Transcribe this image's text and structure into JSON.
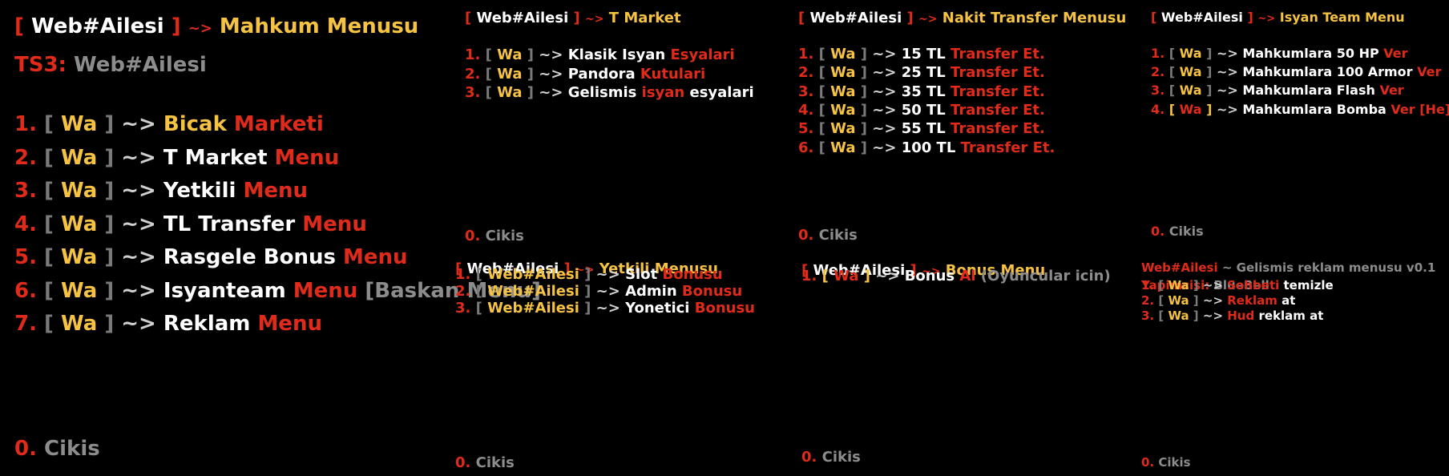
{
  "brand": "Web#Ailesi",
  "tag": "Wa",
  "sep": "~>",
  "exit": {
    "num": "0.",
    "label": "Cikis"
  },
  "mahkum": {
    "title": "Mahkum Menusu",
    "subtitle_prefix": "TS3:",
    "subtitle": "Web#Ailesi",
    "items": [
      {
        "n": "1.",
        "a": "Bicak",
        "b": "Marketi",
        "c": ""
      },
      {
        "n": "2.",
        "a": "T Market",
        "b": "Menu",
        "c": ""
      },
      {
        "n": "3.",
        "a": "Yetkili",
        "b": "Menu",
        "c": ""
      },
      {
        "n": "4.",
        "a": "TL Transfer",
        "b": "Menu",
        "c": ""
      },
      {
        "n": "5.",
        "a": "Rasgele Bonus",
        "b": "Menu",
        "c": ""
      },
      {
        "n": "6.",
        "a": "Isyanteam",
        "b": "Menu",
        "c": "[Baskan Menu]"
      },
      {
        "n": "7.",
        "a": "Reklam",
        "b": "Menu",
        "c": ""
      }
    ]
  },
  "tmarket": {
    "title": "T Market",
    "items": [
      {
        "n": "1.",
        "a": "Klasik Isyan",
        "b": "Esyalari",
        "c": ""
      },
      {
        "n": "2.",
        "a": "Pandora",
        "b": "Kutulari",
        "c": ""
      },
      {
        "n": "3.",
        "a": "Gelismis",
        "b": "isyan",
        "c": "esyalari"
      }
    ]
  },
  "nakit": {
    "title": "Nakit Transfer Menusu",
    "items": [
      {
        "n": "1.",
        "a": "15 TL",
        "b": "Transfer Et."
      },
      {
        "n": "2.",
        "a": "25 TL",
        "b": "Transfer Et."
      },
      {
        "n": "3.",
        "a": "35 TL",
        "b": "Transfer Et."
      },
      {
        "n": "4.",
        "a": "50 TL",
        "b": "Transfer Et."
      },
      {
        "n": "5.",
        "a": "55 TL",
        "b": "Transfer Et."
      },
      {
        "n": "6.",
        "a": "100 TL",
        "b": "Transfer Et."
      }
    ]
  },
  "isyan": {
    "title": "Isyan Team Menu",
    "items": [
      {
        "n": "1.",
        "a": "Mahkumlara 50 HP",
        "b": "Ver",
        "c": ""
      },
      {
        "n": "2.",
        "a": "Mahkumlara 100 Armor",
        "b": "Ver",
        "c": ""
      },
      {
        "n": "3.",
        "a": "Mahkumlara Flash",
        "b": "Ver",
        "c": ""
      },
      {
        "n": "4.",
        "a": "Mahkumlara Bomba",
        "b": "Ver",
        "c": "[He]"
      }
    ]
  },
  "yetkili": {
    "title": "Yetkili Menusu",
    "items": [
      {
        "n": "1.",
        "a": "Slot",
        "b": "Bonusu"
      },
      {
        "n": "2.",
        "a": "Admin",
        "b": "Bonusu"
      },
      {
        "n": "3.",
        "a": "Yonetici",
        "b": "Bonusu"
      }
    ]
  },
  "bonus": {
    "title": "Bonus Menu",
    "items": [
      {
        "n": "1.",
        "a": "Bonus",
        "b": "Al",
        "c": "(Oyuncular icin)"
      }
    ]
  },
  "reklam": {
    "header_brand": "Web#Ailesi",
    "header_rest": "~ Gelismis reklam menusu v0.1",
    "maker_label": "Yapimcisi:",
    "maker": "BlueBell",
    "items": [
      {
        "n": "1.",
        "b": "Sohbeti",
        "c": "temizle"
      },
      {
        "n": "2.",
        "b": "Reklam",
        "c": "at"
      },
      {
        "n": "3.",
        "b": "Hud",
        "c": "reklam at"
      }
    ]
  }
}
